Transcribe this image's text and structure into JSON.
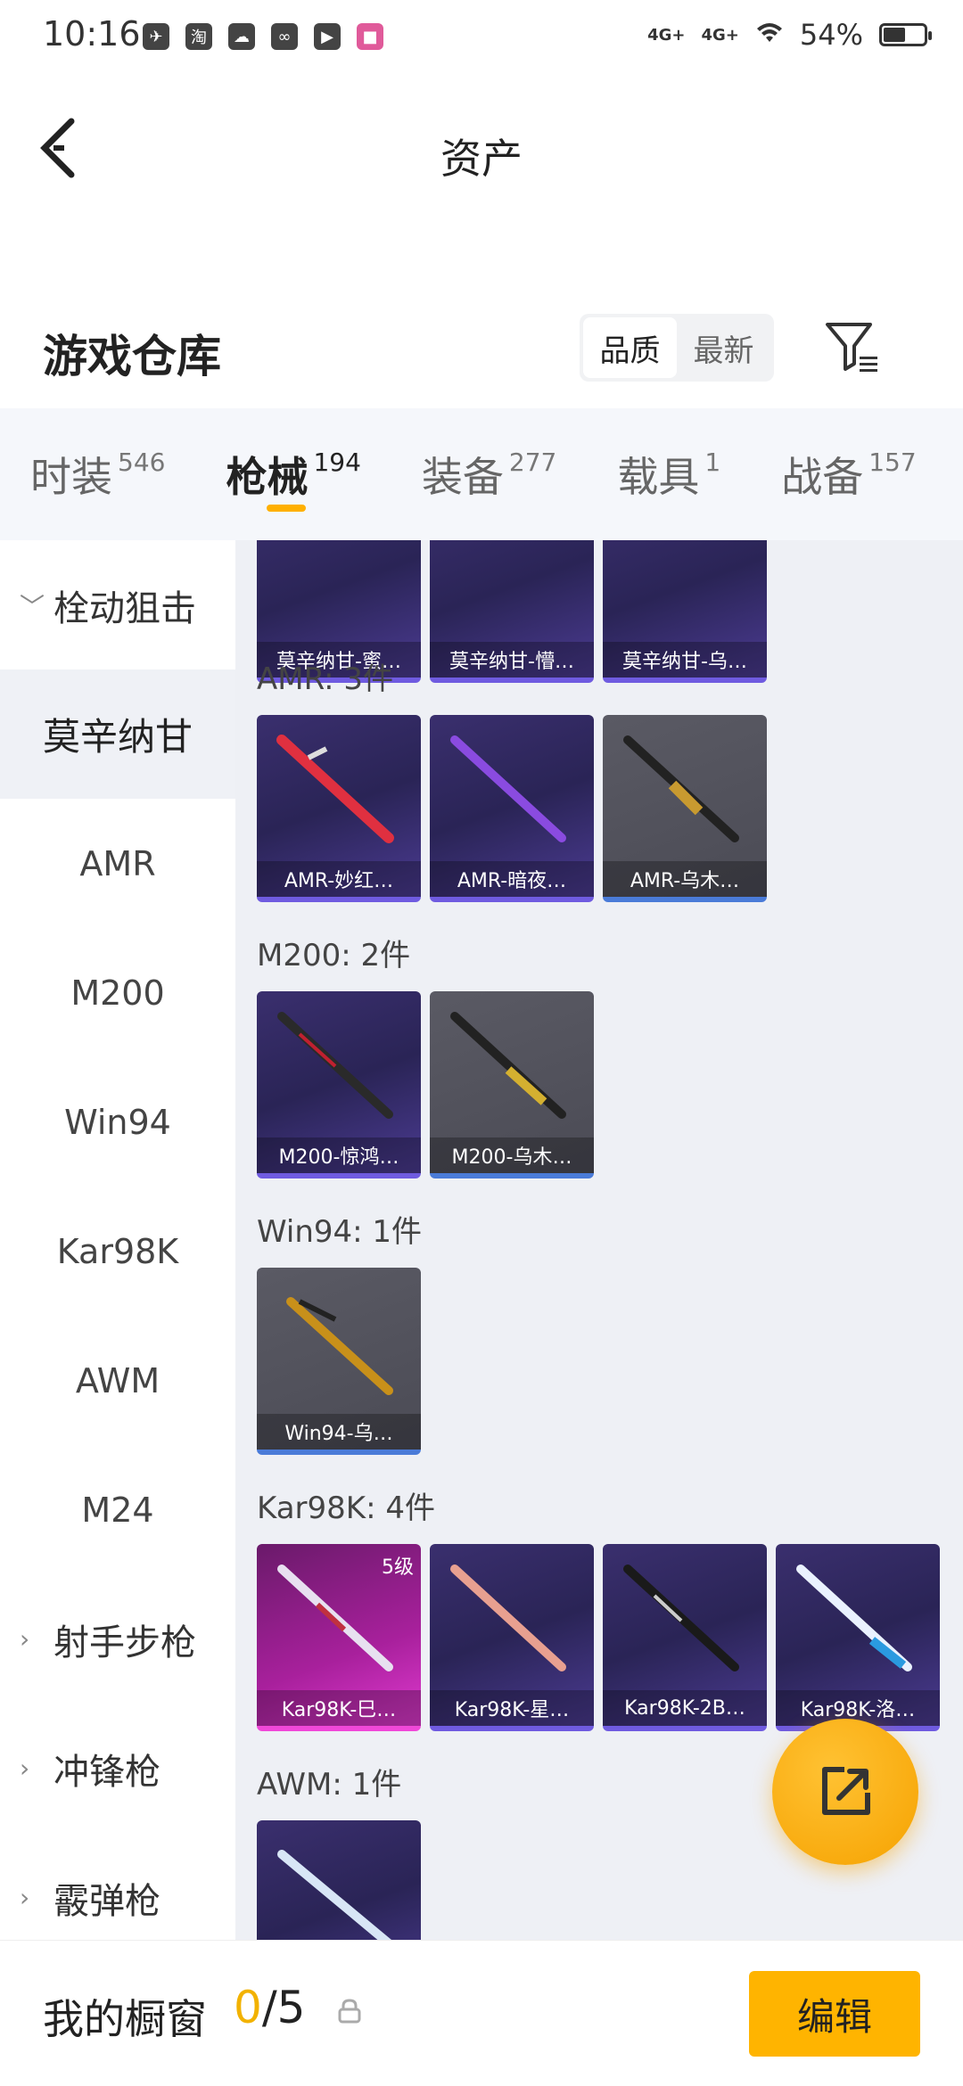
{
  "status_bar": {
    "time": "10:16",
    "net1": "4G+",
    "net2": "4G+",
    "battery": "54%",
    "battery_level": 0.54,
    "icons": [
      "bird-icon",
      "taobao-icon",
      "uc-icon",
      "link-icon",
      "play-icon",
      "news-icon"
    ],
    "taobao_text": "淘"
  },
  "header": {
    "title": "资产",
    "back_icon": "chevron-left-icon"
  },
  "warehouse": {
    "title": "游戏仓库",
    "sort_options": [
      "品质",
      "最新"
    ],
    "active_sort": 0,
    "filter_icon": "filter-icon"
  },
  "tabs": [
    {
      "label": "时装",
      "count": "546"
    },
    {
      "label": "枪械",
      "count": "194"
    },
    {
      "label": "装备",
      "count": "277"
    },
    {
      "label": "载具",
      "count": "1"
    },
    {
      "label": "战备",
      "count": "157"
    }
  ],
  "active_tab": 1,
  "sidebar": {
    "items": [
      {
        "label": "栓动狙击",
        "type": "group",
        "expanded": true
      },
      {
        "label": "莫辛纳甘",
        "type": "item",
        "selected": true
      },
      {
        "label": "AMR",
        "type": "item"
      },
      {
        "label": "M200",
        "type": "item"
      },
      {
        "label": "Win94",
        "type": "item"
      },
      {
        "label": "Kar98K",
        "type": "item"
      },
      {
        "label": "AWM",
        "type": "item"
      },
      {
        "label": "M24",
        "type": "item"
      },
      {
        "label": "射手步枪",
        "type": "group",
        "expanded": false
      },
      {
        "label": "冲锋枪",
        "type": "group",
        "expanded": false
      },
      {
        "label": "霰弹枪",
        "type": "group",
        "expanded": false
      }
    ]
  },
  "content": {
    "top_row": [
      {
        "label": "莫辛纳甘-蜜…",
        "rarity": "purple"
      },
      {
        "label": "莫辛纳甘-懵…",
        "rarity": "purple"
      },
      {
        "label": "莫辛纳甘-乌…",
        "rarity": "purple"
      }
    ],
    "sections": [
      {
        "heading": "AMR: 3件",
        "items": [
          {
            "label": "AMR-妙红…",
            "rarity": "purple"
          },
          {
            "label": "AMR-暗夜…",
            "rarity": "purple"
          },
          {
            "label": "AMR-乌木…",
            "rarity": "gray"
          }
        ]
      },
      {
        "heading": "M200: 2件",
        "items": [
          {
            "label": "M200-惊鸿…",
            "rarity": "purple"
          },
          {
            "label": "M200-乌木…",
            "rarity": "gray"
          }
        ]
      },
      {
        "heading": "Win94: 1件",
        "items": [
          {
            "label": "Win94-乌…",
            "rarity": "gray"
          }
        ]
      },
      {
        "heading": "Kar98K: 4件",
        "items": [
          {
            "label": "Kar98K-巳…",
            "rarity": "pink",
            "level": "5级"
          },
          {
            "label": "Kar98K-星…",
            "rarity": "purple"
          },
          {
            "label": "Kar98K-2B…",
            "rarity": "purple"
          },
          {
            "label": "Kar98K-洛…",
            "rarity": "purple"
          }
        ]
      },
      {
        "heading": "AWM: 1件",
        "items": [
          {
            "label": "",
            "rarity": "purple"
          }
        ]
      }
    ]
  },
  "share_button": {
    "icon": "share-external-icon"
  },
  "bottom_bar": {
    "title": "我的橱窗",
    "count_current": "0",
    "count_sep": "/5",
    "lock_icon": "lock-icon",
    "edit_label": "编辑"
  },
  "colors": {
    "accent": "#ffb400",
    "purple_card": "#2a2456",
    "gray_card": "#4b4b55",
    "pink_card": "#a8209c",
    "content_bg": "#eef0f5"
  }
}
